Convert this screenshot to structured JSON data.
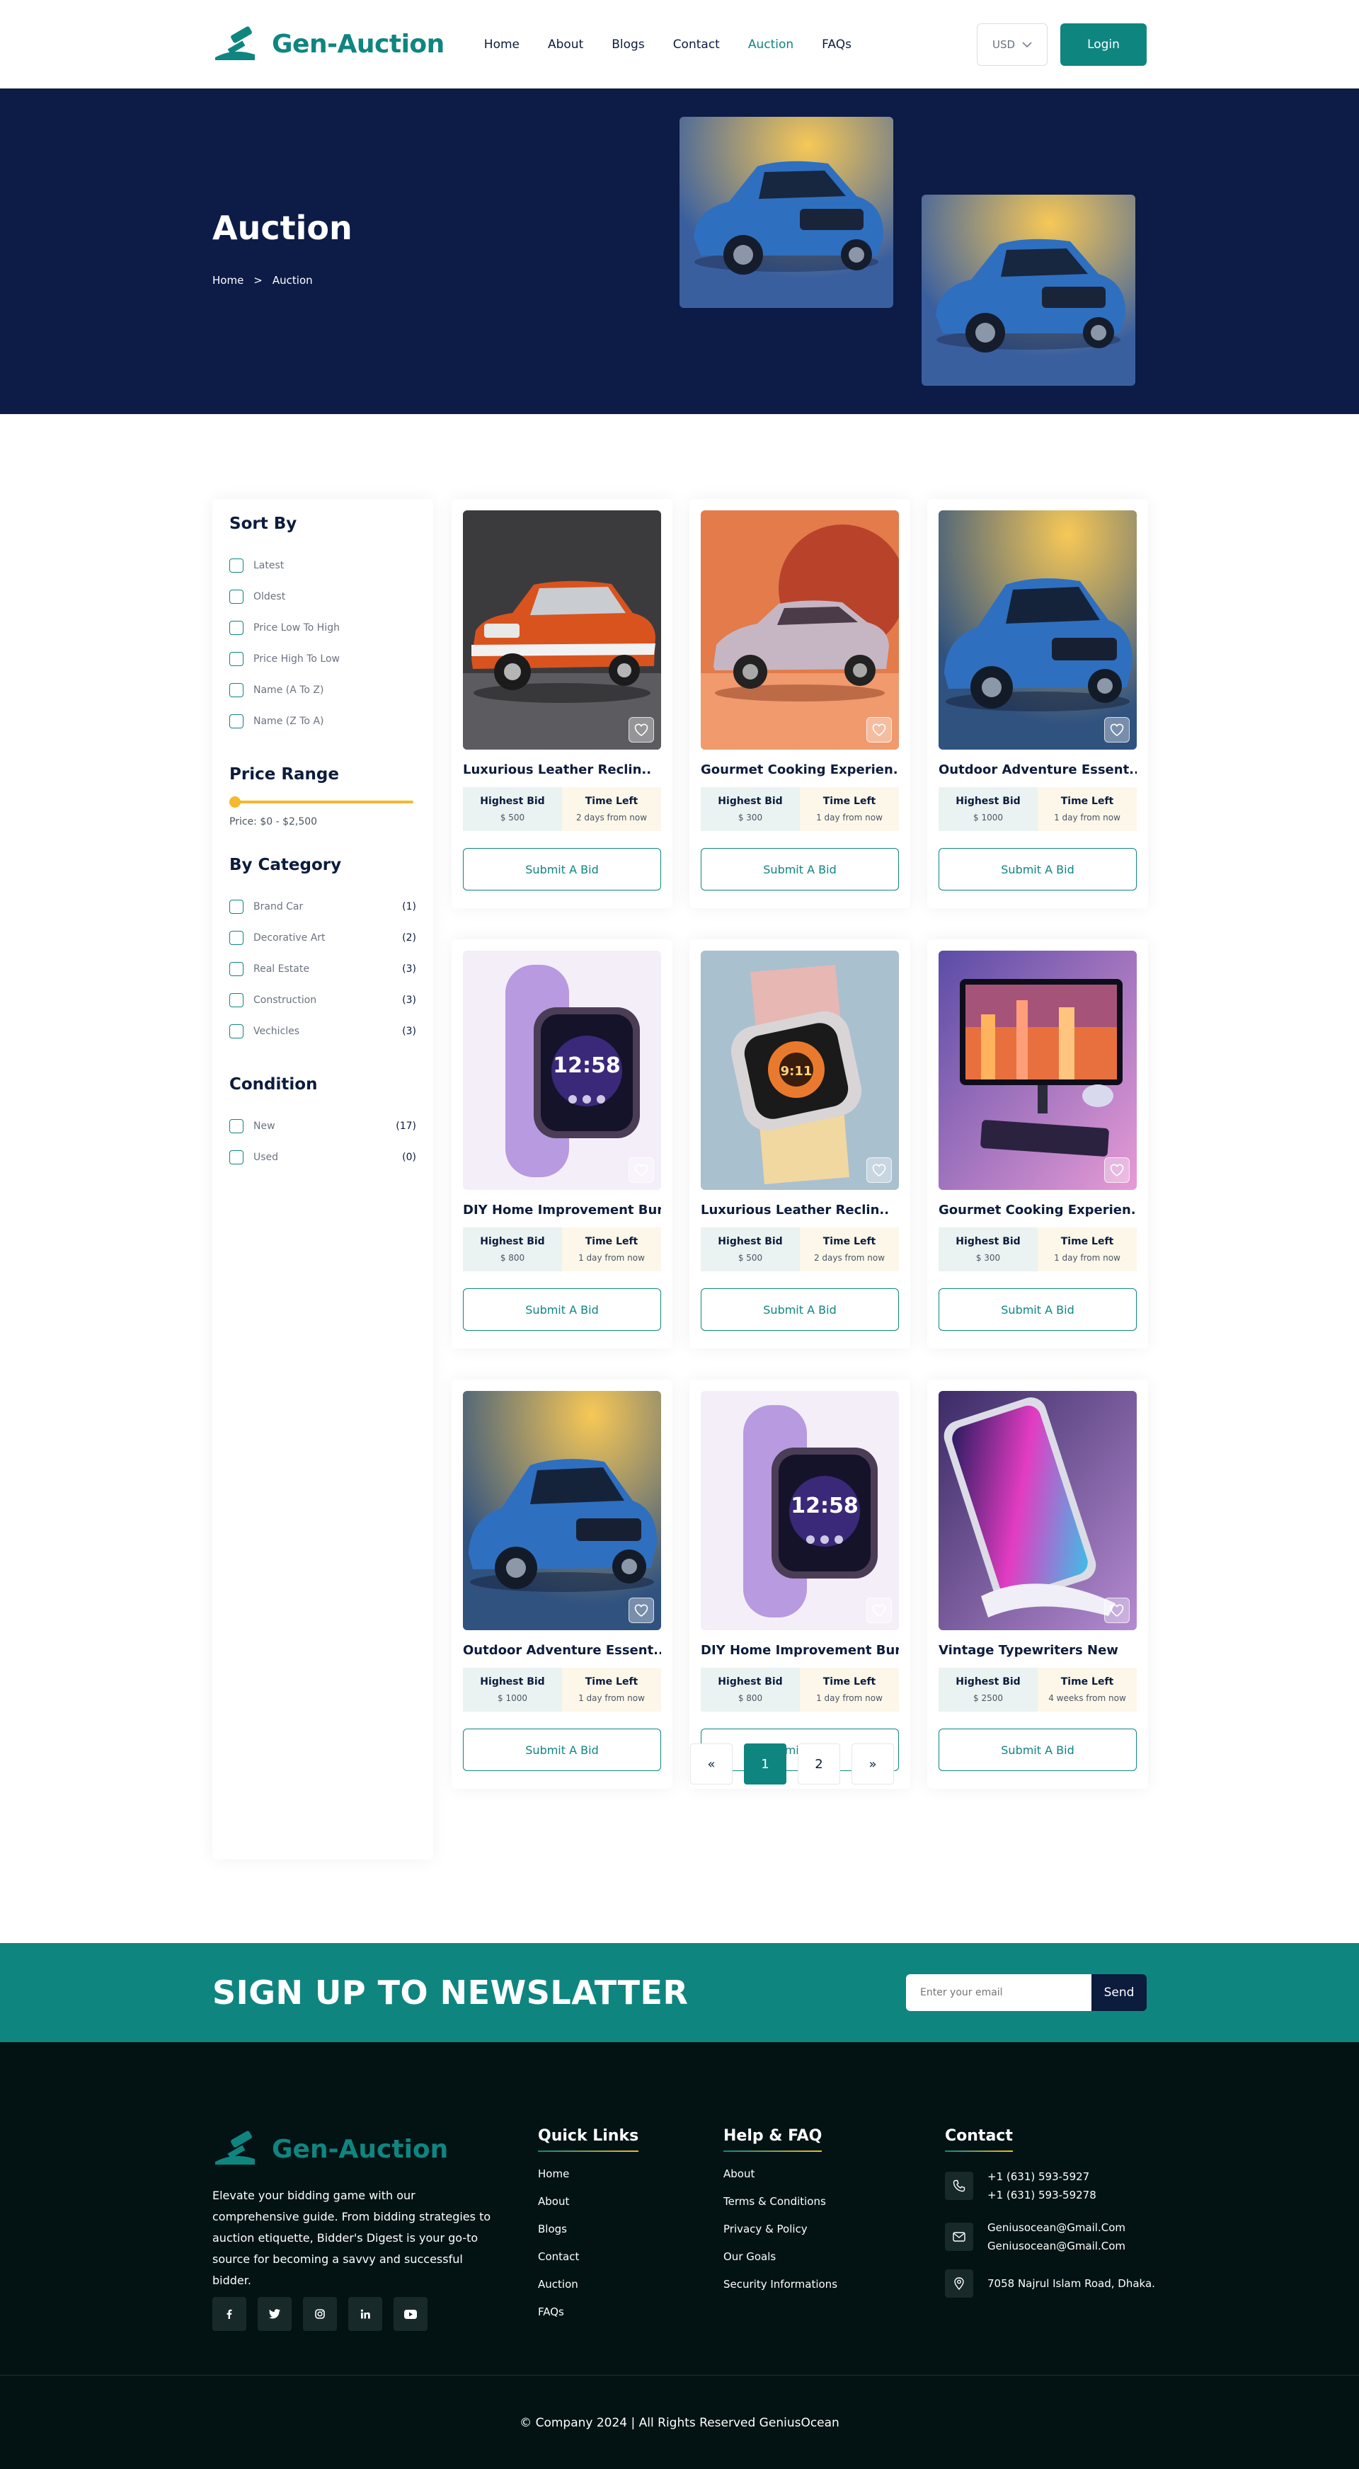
{
  "brand": {
    "name": "Gen-Auction",
    "primary": "#0f8580",
    "navy": "#0c1c47",
    "accent": "#f5b82e"
  },
  "nav": [
    {
      "label": "Home"
    },
    {
      "label": "About"
    },
    {
      "label": "Blogs"
    },
    {
      "label": "Contact"
    },
    {
      "label": "Auction",
      "active": true
    },
    {
      "label": "FAQs"
    }
  ],
  "header": {
    "currency": "USD",
    "login": "Login"
  },
  "hero": {
    "title": "Auction",
    "breadcrumb": {
      "home": "Home",
      "sep": ">",
      "current": "Auction"
    }
  },
  "sidebar": {
    "sort_title": "Sort By",
    "sort_options": [
      "Latest",
      "Oldest",
      "Price Low To High",
      "Price High To Low",
      "Name (A To Z)",
      "Name (Z To A)"
    ],
    "price_title": "Price Range",
    "price_text": "Price: $0 - $2,500",
    "category_title": "By Category",
    "categories": [
      {
        "name": "Brand Car",
        "count": "(1)"
      },
      {
        "name": "Decorative Art",
        "count": "(2)"
      },
      {
        "name": "Real Estate",
        "count": "(3)"
      },
      {
        "name": "Construction",
        "count": "(3)"
      },
      {
        "name": "Vechicles",
        "count": "(3)"
      }
    ],
    "condition_title": "Condition",
    "conditions": [
      {
        "name": "New",
        "count": "(17)"
      },
      {
        "name": "Used",
        "count": "(0)"
      }
    ]
  },
  "labels": {
    "highest_bid": "Highest Bid",
    "time_left": "Time Left",
    "submit": "Submit A Bid"
  },
  "products": [
    {
      "title": "Luxurious Leather Reclin..",
      "bid": "$ 500",
      "time": "2 days from now",
      "image": "car-orange"
    },
    {
      "title": "Gourmet Cooking Experien..",
      "bid": "$ 300",
      "time": "1 day from now",
      "image": "car-silver"
    },
    {
      "title": "Outdoor Adventure Essent..",
      "bid": "$ 1000",
      "time": "1 day from now",
      "image": "car-blue"
    },
    {
      "title": "DIY Home Improvement Bun..",
      "bid": "$ 800",
      "time": "1 day from now",
      "image": "watch-purple"
    },
    {
      "title": "Luxurious Leather Reclin..",
      "bid": "$ 500",
      "time": "2 days from now",
      "image": "watch-pink"
    },
    {
      "title": "Gourmet Cooking Experien..",
      "bid": "$ 300",
      "time": "1 day from now",
      "image": "computer"
    },
    {
      "title": "Outdoor Adventure Essent..",
      "bid": "$ 1000",
      "time": "1 day from now",
      "image": "car-blue"
    },
    {
      "title": "DIY Home Improvement Bun..",
      "bid": "$ 800",
      "time": "1 day from now",
      "image": "watch-purple"
    },
    {
      "title": "Vintage Typewriters New",
      "bid": "$ 2500",
      "time": "4 weeks from now",
      "image": "phone"
    }
  ],
  "pagination": {
    "prev": "«",
    "pages": [
      "1",
      "2"
    ],
    "current": "1",
    "next": "»"
  },
  "newsletter": {
    "title": "SIGN UP TO NEWSLATTER",
    "placeholder": "Enter your email",
    "button": "Send"
  },
  "footer": {
    "description": "Elevate your bidding game with our comprehensive guide. From bidding strategies to auction etiquette, Bidder's Digest is your go-to source for becoming a savvy and successful bidder.",
    "socials": [
      "facebook-icon",
      "twitter-icon",
      "instagram-icon",
      "linkedin-icon",
      "youtube-icon"
    ],
    "quick_title": "Quick Links",
    "quick_links": [
      "Home",
      "About",
      "Blogs",
      "Contact",
      "Auction",
      "FAQs"
    ],
    "help_title": "Help & FAQ",
    "help_links": [
      "About",
      "Terms & Conditions",
      "Privacy & Policy",
      "Our Goals",
      "Security Informations"
    ],
    "contact_title": "Contact",
    "phones": [
      "+1 (631) 593-5927",
      "+1 (631) 593-59278"
    ],
    "emails": [
      "Geniusocean@Gmail.Com",
      "Geniusocean@Gmail.Com"
    ],
    "address": "7058 Najrul Islam Road, Dhaka.",
    "copyright": "© Company 2024 | All Rights Reserved GeniusOcean"
  }
}
